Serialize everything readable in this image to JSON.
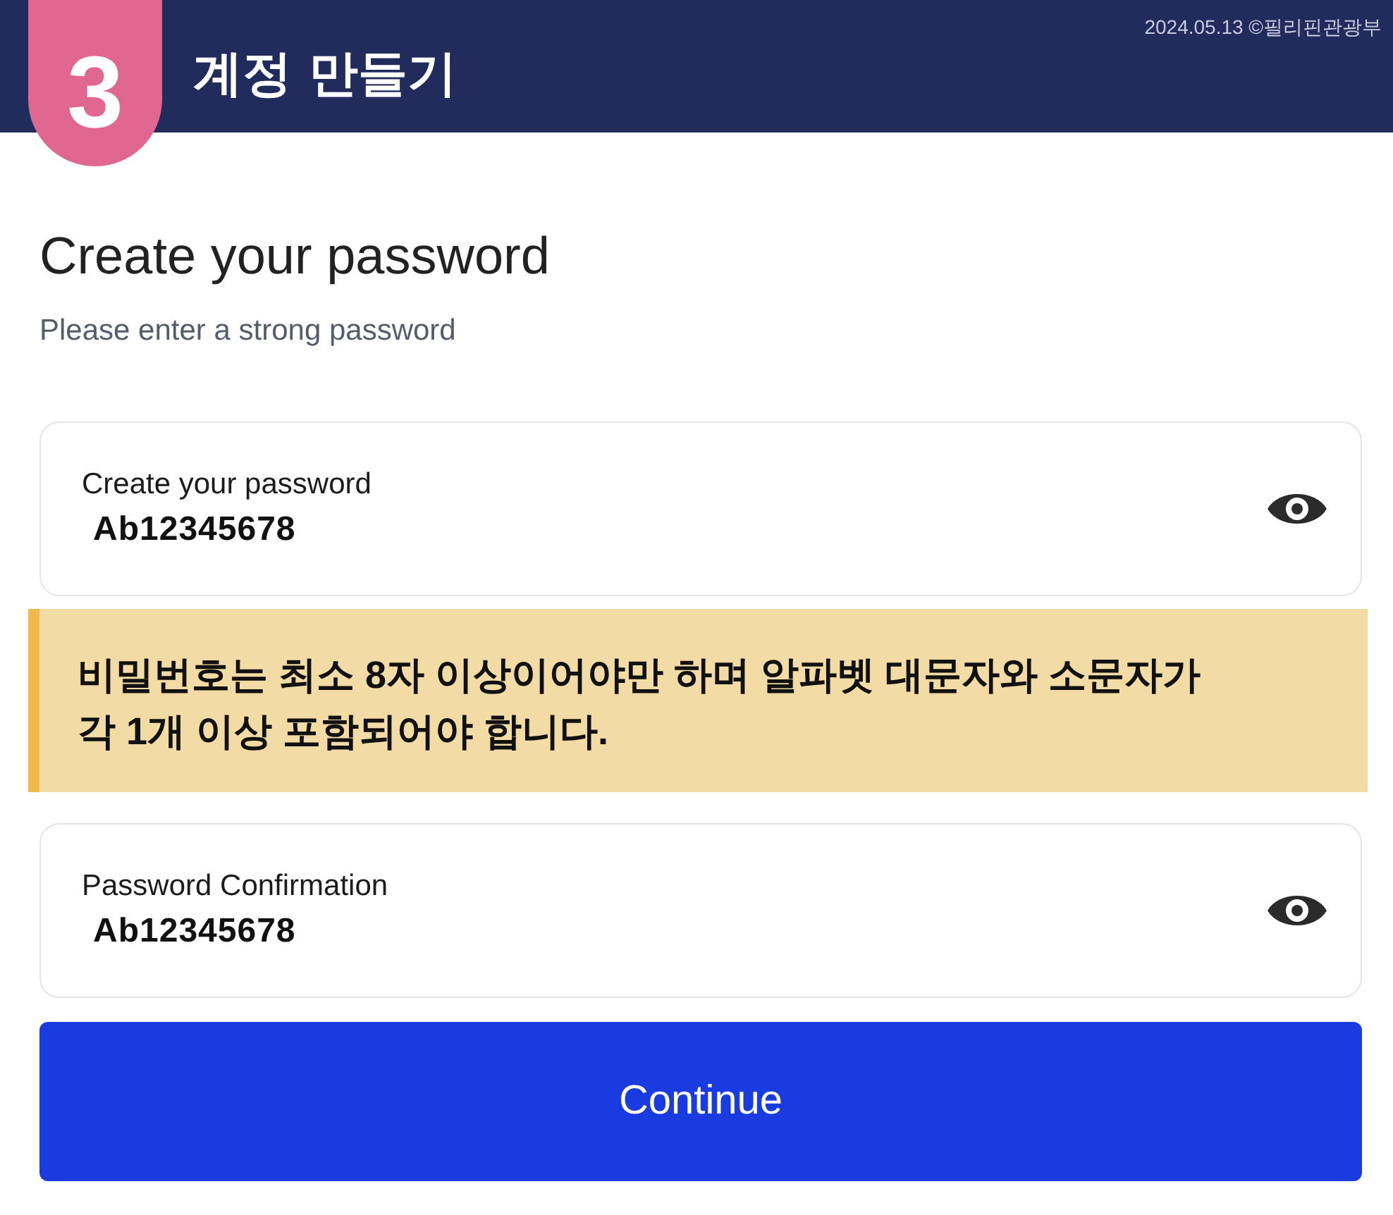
{
  "header": {
    "step": "3",
    "title": "계정 만들기",
    "credit": "2024.05.13 ©필리핀관광부"
  },
  "page": {
    "title": "Create your password",
    "subtitle": "Please enter a strong password"
  },
  "sections": [
    {
      "kind": "field",
      "label": "Create your password",
      "value": "Ab12345678"
    },
    {
      "kind": "note",
      "text": "비밀번호는 최소 8자 이상이어야만 하며 알파벳 대문자와 소문자가 각 1개 이상 포함되어야 합니다."
    },
    {
      "kind": "field",
      "label": "Password Confirmation",
      "value": "Ab12345678"
    }
  ],
  "continue_button": {
    "label": "Continue"
  }
}
